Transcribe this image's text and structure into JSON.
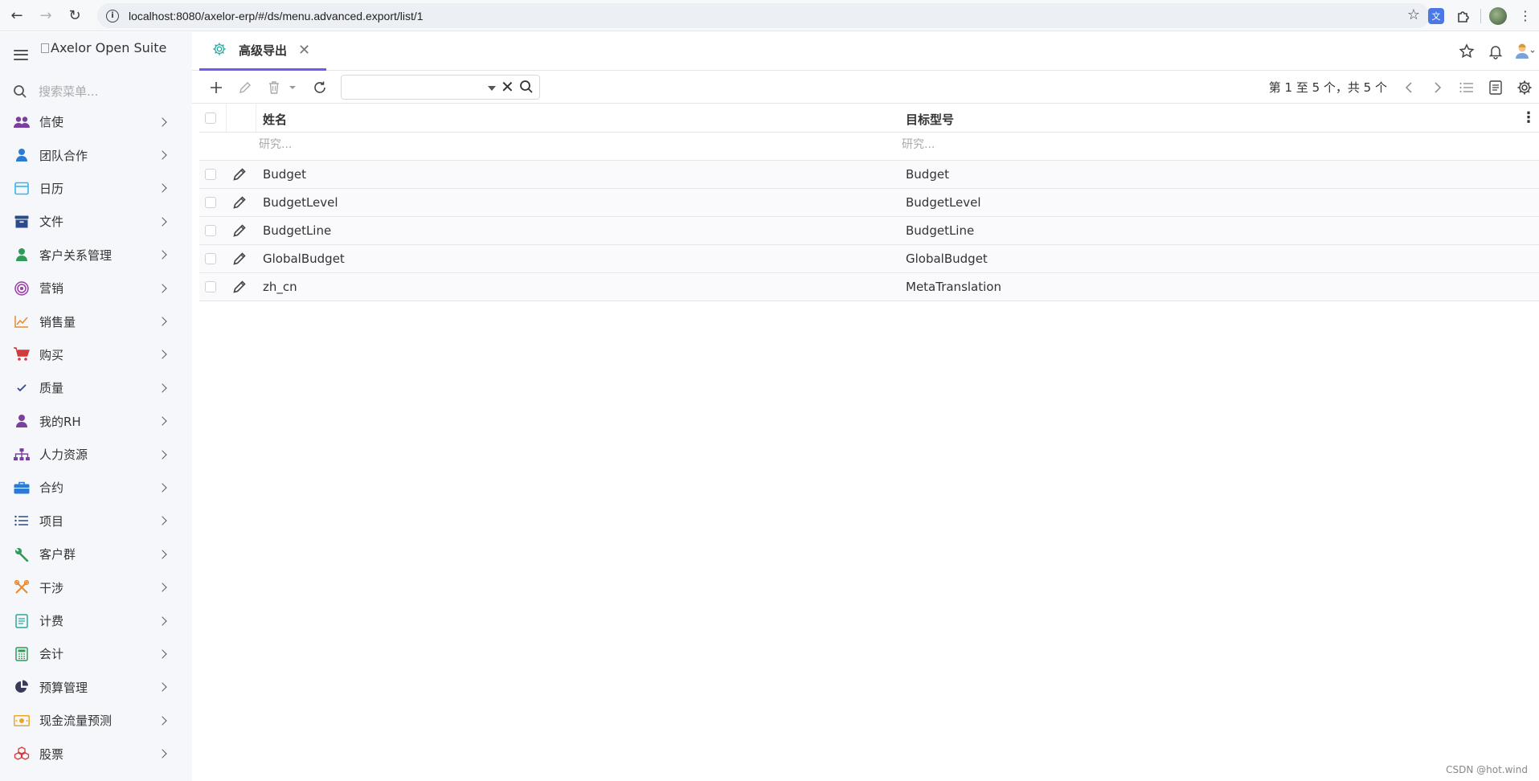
{
  "browser": {
    "url": "localhost:8080/axelor-erp/#/ds/menu.advanced.export/list/1"
  },
  "sidebar": {
    "logo_alt": "Axelor Open Suite",
    "search_placeholder": "搜索菜单...",
    "items": [
      {
        "label": "信使",
        "icon": "users-icon",
        "color": "#7b3fa0"
      },
      {
        "label": "团队合作",
        "icon": "user-icon",
        "color": "#2b7ad6"
      },
      {
        "label": "日历",
        "icon": "calendar-icon",
        "color": "#35b8e8"
      },
      {
        "label": "文件",
        "icon": "archive-icon",
        "color": "#2b4b8a"
      },
      {
        "label": "客户关系管理",
        "icon": "user-icon",
        "color": "#2e9b57"
      },
      {
        "label": "营销",
        "icon": "target-icon",
        "color": "#9b3aa8"
      },
      {
        "label": "销售量",
        "icon": "chart-line-icon",
        "color": "#e88a2a"
      },
      {
        "label": "购买",
        "icon": "cart-icon",
        "color": "#d43a3a"
      },
      {
        "label": "质量",
        "icon": "check-icon",
        "color": "#2b4b8a"
      },
      {
        "label": "我的RH",
        "icon": "user-icon",
        "color": "#7b3fa0"
      },
      {
        "label": "人力资源",
        "icon": "sitemap-icon",
        "color": "#7b3fa0"
      },
      {
        "label": "合约",
        "icon": "briefcase-icon",
        "color": "#2b7ad6"
      },
      {
        "label": "项目",
        "icon": "list-icon",
        "color": "#2b4b8a"
      },
      {
        "label": "客户群",
        "icon": "wrench-icon",
        "color": "#2e9b57"
      },
      {
        "label": "干涉",
        "icon": "tools-icon",
        "color": "#e88a2a"
      },
      {
        "label": "计费",
        "icon": "document-icon",
        "color": "#2aa8a0"
      },
      {
        "label": "会计",
        "icon": "calculator-icon",
        "color": "#2e9b57"
      },
      {
        "label": "预算管理",
        "icon": "pie-chart-icon",
        "color": "#3a3a5a"
      },
      {
        "label": "现金流量预测",
        "icon": "money-icon",
        "color": "#e8a92a"
      },
      {
        "label": "股票",
        "icon": "cubes-icon",
        "color": "#d43a3a"
      }
    ]
  },
  "tab": {
    "title": "高级导出"
  },
  "toolbar": {
    "pager_text": "第 1 至 5 个，共 5 个"
  },
  "grid": {
    "columns": [
      "姓名",
      "目标型号"
    ],
    "filter_placeholders": [
      "研究...",
      "研究..."
    ],
    "rows": [
      {
        "name": "Budget",
        "model": "Budget"
      },
      {
        "name": "BudgetLevel",
        "model": "BudgetLevel"
      },
      {
        "name": "BudgetLine",
        "model": "BudgetLine"
      },
      {
        "name": "GlobalBudget",
        "model": "GlobalBudget"
      },
      {
        "name": "zh_cn",
        "model": "MetaTranslation"
      }
    ]
  },
  "watermark": "CSDN @hot.wind"
}
